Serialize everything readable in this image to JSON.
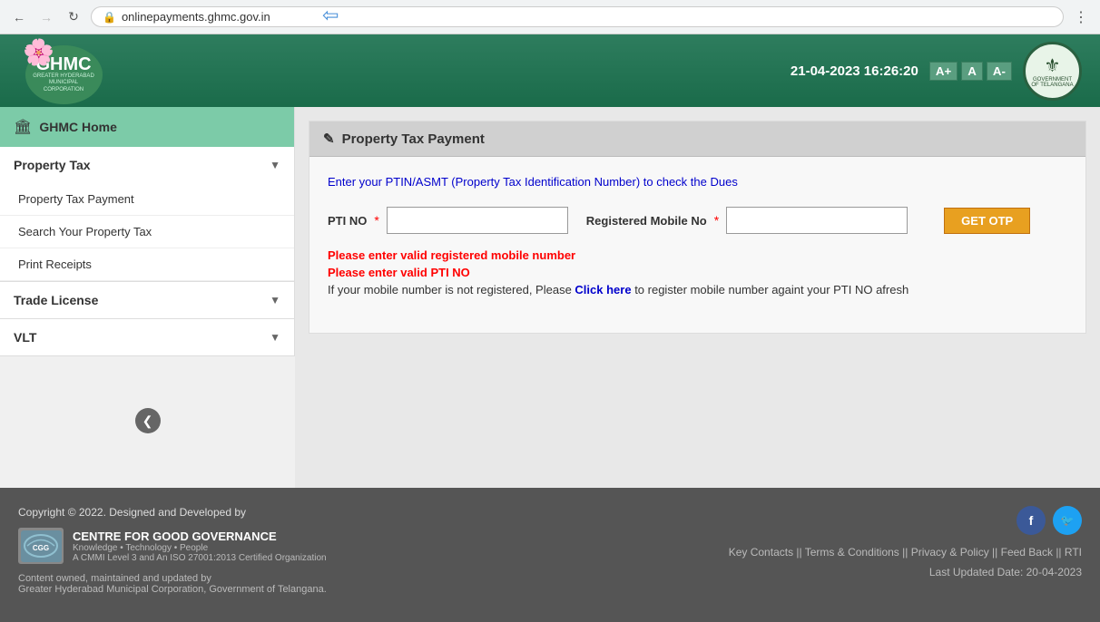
{
  "browser": {
    "url": "onlinepayments.ghmc.gov.in",
    "back_disabled": false,
    "forward_disabled": true
  },
  "header": {
    "logo_text": "GHMC",
    "logo_subtext": "GREATER HYDERABAD MUNICIPAL CORPORATION",
    "datetime": "21-04-2023 16:26:20",
    "font_increase": "A+",
    "font_normal": "A",
    "font_decrease": "A-"
  },
  "sidebar": {
    "home_label": "GHMC Home",
    "sections": [
      {
        "label": "Property Tax",
        "items": [
          "Property Tax Payment",
          "Search Your Property Tax",
          "Print Receipts"
        ]
      },
      {
        "label": "Trade License",
        "items": []
      },
      {
        "label": "VLT",
        "items": []
      }
    ]
  },
  "content": {
    "panel_title": "Property Tax Payment",
    "ptin_instruction": "Enter your PTIN/ASMT (Property Tax Identification Number) to check the Dues",
    "pti_no_label": "PTI NO",
    "mobile_label": "Registered Mobile No",
    "pti_no_placeholder": "",
    "mobile_placeholder": "",
    "get_otp_label": "GET OTP",
    "errors": {
      "mobile": "Please enter valid registered mobile number",
      "pti": "Please enter valid PTI NO",
      "register_prefix": "If your mobile number is not registered, Please ",
      "click_here": "Click here",
      "register_suffix": " to register mobile number againt your PTI NO afresh"
    }
  },
  "footer": {
    "copyright": "Copyright © 2022. Designed and Developed by",
    "cgg_name": "CENTRE FOR GOOD GOVERNANCE",
    "cgg_subtitle": "Knowledge • Technology • People",
    "cgg_certified": "A CMMI Level 3 and An ISO 27001:2013 Certified Organization",
    "content_info": "Content owned, maintained and updated by\nGreater Hyderabad Municipal Corporation, Government of Telangana.",
    "links": "Key Contacts || Terms & Conditions || Privacy & Policy || Feed Back || RTI",
    "last_updated": "Last Updated Date: 20-04-2023",
    "social_fb": "f",
    "social_tw": "t"
  }
}
